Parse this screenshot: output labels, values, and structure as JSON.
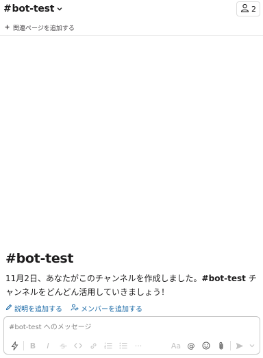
{
  "header": {
    "hash": "#",
    "channel_name": "bot-test",
    "member_count": "2"
  },
  "bookmarks": {
    "add_label": "関連ページを追加する"
  },
  "intro": {
    "title_hash": "#",
    "title_name": "bot-test",
    "text_before": "11月2日、あなたがこのチャンネルを作成しました。",
    "text_channel": "#bot-test",
    "text_after": " チャンネルをどんどん活用していきましょう！",
    "add_description_label": "説明を追加する",
    "add_members_label": "メンバーを追加する"
  },
  "composer": {
    "placeholder": "#bot-test へのメッセージ",
    "toolbar": {
      "bold": "B",
      "italic": "I",
      "more": "···",
      "text_format": "Aa",
      "mention": "@"
    }
  }
}
